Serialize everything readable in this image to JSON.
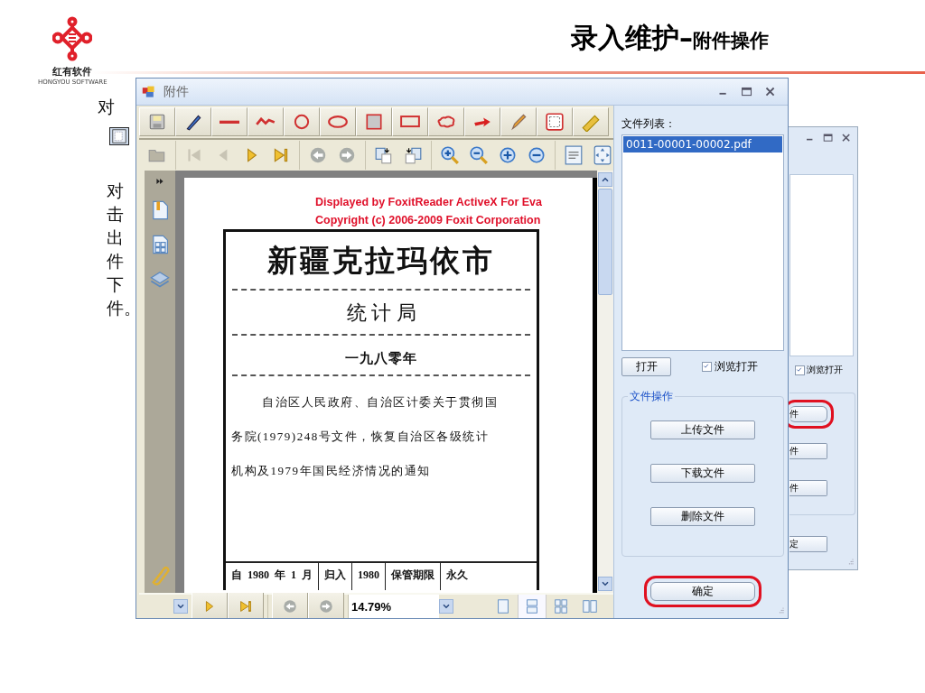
{
  "header": {
    "logo_text": "红有软件",
    "logo_subtext": "HONGYOU SOFTWARE",
    "title": "录入维护–",
    "title_suffix": "附件操作"
  },
  "slide_text": {
    "top_line": "对",
    "lines": [
      "对",
      "击",
      "出",
      "件",
      "下",
      "件。"
    ]
  },
  "background_window": {
    "checkbox": {
      "label": "浏览打开",
      "checked": true
    },
    "buttons": [
      {
        "label": "件",
        "highlighted": true
      },
      {
        "label": "件",
        "highlighted": false
      },
      {
        "label": "件",
        "highlighted": false
      }
    ],
    "ok_button": {
      "label": "定",
      "highlighted": false
    }
  },
  "window": {
    "title": "附件",
    "viewer": {
      "notice": [
        "Displayed by FoxitReader ActiveX For Eva",
        "Copyright (c) 2006-2009 Foxit Corporation"
      ],
      "document": {
        "title": "新疆克拉玛依市",
        "department": "统 计 局",
        "year": "一九八零年",
        "lines": [
          "自治区人民政府、自治区计委关于贯彻国",
          "务院(1979)248号文件，恢复自治区各级统计",
          "机构及1979年国民经济情况的通知"
        ],
        "table_cells": [
          [
            "自",
            "1980",
            "年",
            "1",
            "月"
          ],
          [
            "归入"
          ],
          [
            "1980"
          ],
          [
            "保管期限"
          ],
          [
            "永久"
          ]
        ]
      },
      "zoom": "14.79%",
      "view_modes": [
        {
          "selected": false
        },
        {
          "selected": true
        },
        {
          "selected": false
        },
        {
          "selected": false
        }
      ]
    },
    "file_list_label": "文件列表：",
    "files": [
      {
        "name": "0011-00001-00002.pdf",
        "selected": true
      }
    ],
    "open_button": "打开",
    "browse_checkbox": {
      "label": "浏览打开",
      "checked": true
    },
    "group_label": "文件操作",
    "group_buttons": [
      "上传文件",
      "下载文件",
      "删除文件"
    ],
    "ok_button": {
      "label": "确定",
      "highlighted": true
    }
  }
}
